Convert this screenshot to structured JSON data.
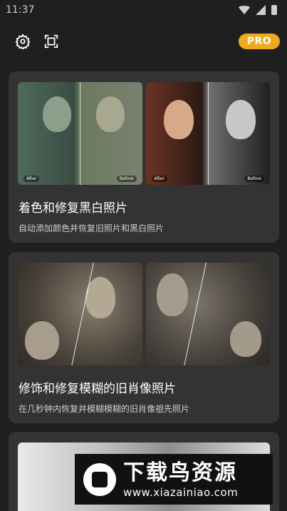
{
  "status": {
    "time": "11:37"
  },
  "topbar": {
    "settings_icon": "gear-icon",
    "scan_icon": "scan-frame-icon",
    "pro": "PRO"
  },
  "cards": [
    {
      "title": "着色和修复黑白照片",
      "subtitle": "自动添加颜色并恢复旧照片和黑白照片",
      "after": "After",
      "before": "Before"
    },
    {
      "title": "修饰和修复模糊的旧肖像照片",
      "subtitle": "在几秒钟内恢复并模糊模糊的旧肖像祖先照片"
    }
  ],
  "watermark": {
    "name": "下载鸟资源",
    "url": "www.xiazainiao.com"
  }
}
